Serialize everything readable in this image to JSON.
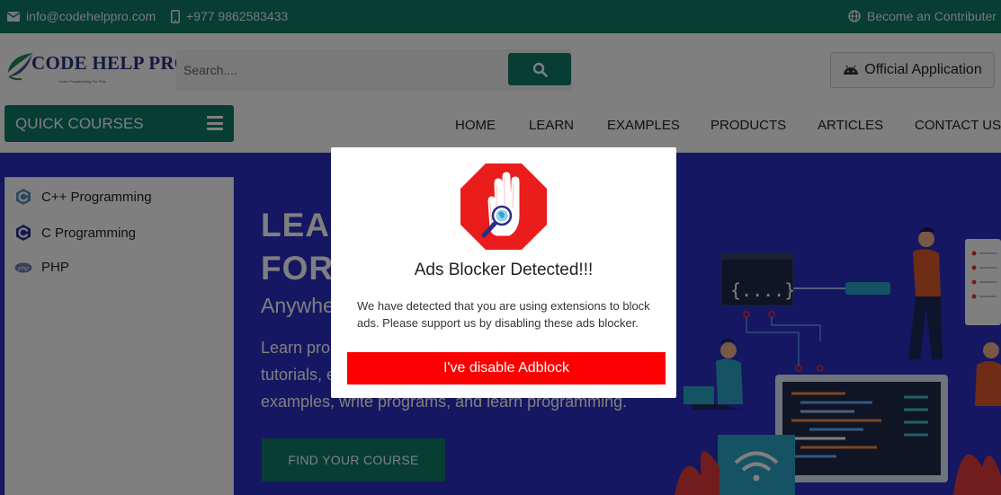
{
  "topbar": {
    "email": "info@codehelppro.com",
    "phone": "+977 9862583433",
    "contributor": "Become an Contributer"
  },
  "header": {
    "logo_text": "CODE HELP PRO",
    "logo_tagline": "Learn Programming For Free",
    "search_placeholder": "Search....",
    "app_button": "Official Application"
  },
  "nav": {
    "quick_courses": "QUICK COURSES",
    "items": [
      "HOME",
      "LEARN",
      "EXAMPLES",
      "PRODUCTS",
      "ARTICLES",
      "CONTACT US"
    ]
  },
  "sidebar": {
    "items": [
      {
        "label": "C++ Programming",
        "icon": "cpp-icon"
      },
      {
        "label": "C Programming",
        "icon": "c-icon"
      },
      {
        "label": "PHP",
        "icon": "php-icon"
      }
    ]
  },
  "hero": {
    "title_line1": "LEA",
    "title_line2": "FOR",
    "subtitle": "Anywhe",
    "desc_line1": "Learn pro",
    "desc_line2": "tutorials, e",
    "desc_line3": "examples, write programs, and learn programming.",
    "find_button": "FIND YOUR COURSE",
    "code_snippet": "{....}"
  },
  "modal": {
    "title": "Ads Blocker Detected!!!",
    "message": "We have detected that you are using extensions to block ads. Please support us by disabling these ads blocker.",
    "button": "I've disable Adblock"
  },
  "colors": {
    "brand_green": "#0e7a66",
    "hero_blue": "#2b2ec4",
    "alert_red": "#fb0000"
  }
}
